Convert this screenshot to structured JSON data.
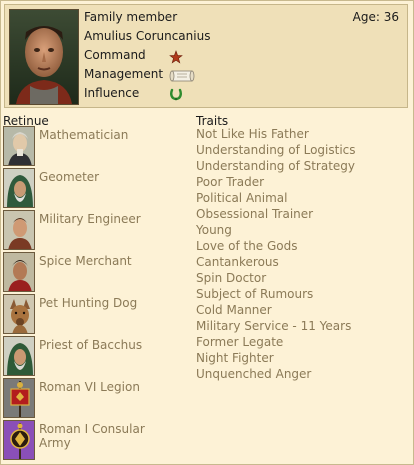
{
  "character": {
    "role": "Family member",
    "name": "Amulius Coruncanius",
    "age_label": "Age: 36",
    "stats": {
      "command_label": "Command",
      "management_label": "Management",
      "influence_label": "Influence",
      "command_icon": "star-icon",
      "management_icon": "scroll-icon",
      "influence_icon": "laurel-icon"
    }
  },
  "retinue": {
    "heading": "Retinue",
    "items": [
      {
        "label": "Mathematician",
        "icon": "mathematician-portrait-icon"
      },
      {
        "label": "Geometer",
        "icon": "geometer-portrait-icon"
      },
      {
        "label": "Military Engineer",
        "icon": "engineer-portrait-icon"
      },
      {
        "label": "Spice Merchant",
        "icon": "merchant-portrait-icon"
      },
      {
        "label": "Pet Hunting Dog",
        "icon": "dog-portrait-icon"
      },
      {
        "label": "Priest of Bacchus",
        "icon": "priest-portrait-icon"
      },
      {
        "label": "Roman VI Legion",
        "icon": "legion-standard-icon"
      },
      {
        "label": "Roman I Consular Army",
        "icon": "consular-standard-icon"
      }
    ]
  },
  "traits": {
    "heading": "Traits",
    "items": [
      "Not Like His Father",
      "Understanding of Logistics",
      "Understanding of Strategy",
      "Poor Trader",
      "Political Animal",
      "Obsessional Trainer",
      "Young",
      "Love of the Gods",
      "Cantankerous",
      "Spin Doctor",
      "Subject of Rumours",
      "Cold Manner",
      "Military Service - 11 Years",
      "Former Legate",
      "Night Fighter",
      "Unquenched Anger"
    ]
  },
  "colors": {
    "background": "#fdf2d6",
    "header_bg": "#efe0b8",
    "faded_text": "#8b7a57",
    "command_star": "#b03a1a",
    "influence_laurel": "#2e8b2e"
  }
}
